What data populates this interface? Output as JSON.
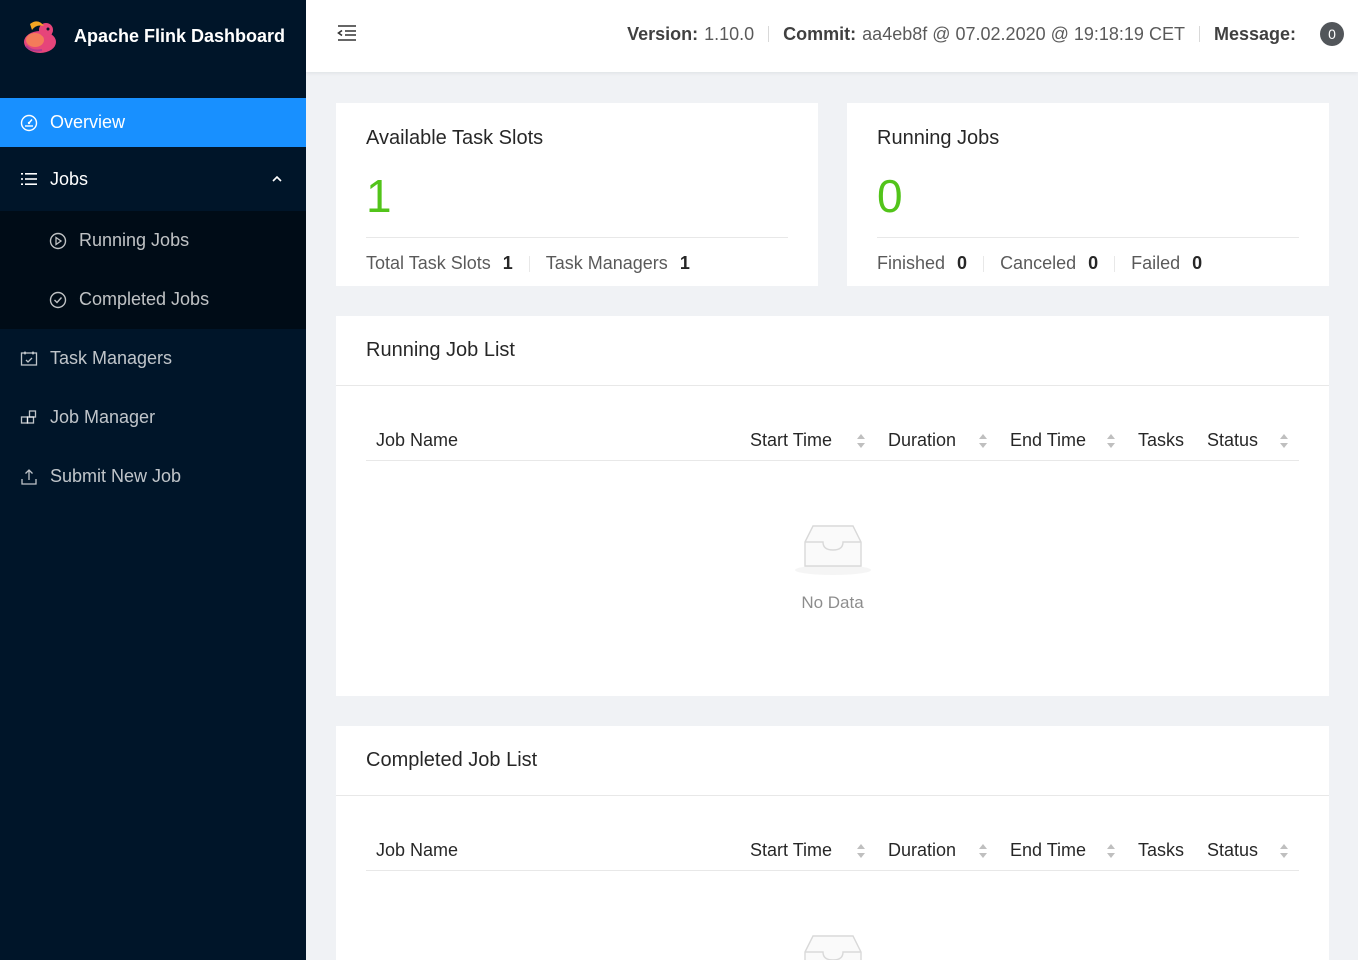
{
  "brand": {
    "title": "Apache Flink Dashboard",
    "logo": "flink-squirrel-logo"
  },
  "sidebar": {
    "overview": "Overview",
    "jobs": "Jobs",
    "running_jobs": "Running Jobs",
    "completed_jobs": "Completed Jobs",
    "task_managers": "Task Managers",
    "job_manager": "Job Manager",
    "submit_new_job": "Submit New Job"
  },
  "header": {
    "version_label": "Version:",
    "version": "1.10.0",
    "commit_label": "Commit:",
    "commit": "aa4eb8f @ 07.02.2020 @ 19:18:19 CET",
    "message_label": "Message:",
    "message_count": "0"
  },
  "task_slots": {
    "title": "Available Task Slots",
    "value": "1",
    "total_label": "Total Task Slots",
    "total": "1",
    "tm_label": "Task Managers",
    "tm": "1"
  },
  "running_jobs_card": {
    "title": "Running Jobs",
    "value": "0",
    "finished_label": "Finished",
    "finished": "0",
    "canceled_label": "Canceled",
    "canceled": "0",
    "failed_label": "Failed",
    "failed": "0"
  },
  "running_list": {
    "title": "Running Job List",
    "columns": [
      "Job Name",
      "Start Time",
      "Duration",
      "End Time",
      "Tasks",
      "Status"
    ],
    "empty": "No Data"
  },
  "completed_list": {
    "title": "Completed Job List",
    "columns": [
      "Job Name",
      "Start Time",
      "Duration",
      "End Time",
      "Tasks",
      "Status"
    ]
  },
  "colors": {
    "sidebar": "#001529",
    "active": "#1890ff",
    "value_green": "#52c41a"
  }
}
